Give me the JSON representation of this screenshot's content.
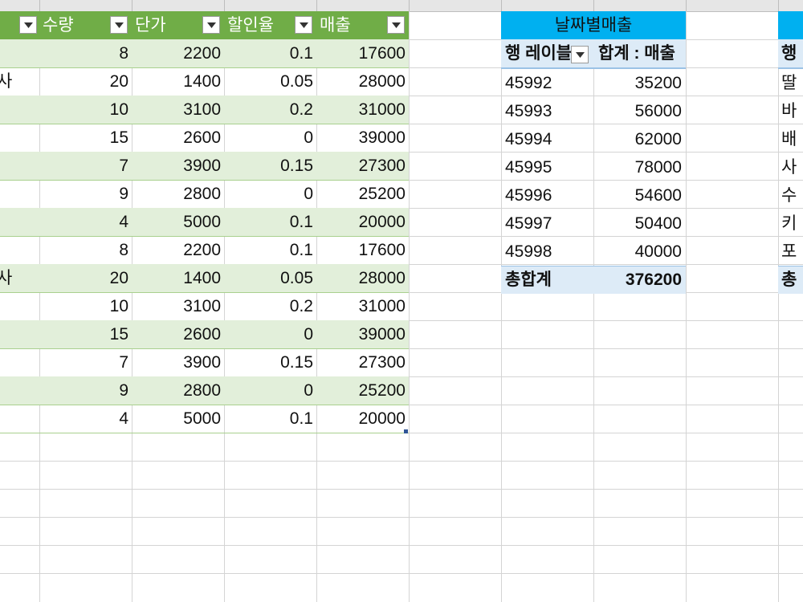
{
  "table": {
    "headers": [
      "수량",
      "단가",
      "할인율",
      "매출"
    ],
    "left_fragments": [
      "",
      "사",
      "",
      "",
      "",
      "",
      "",
      "",
      "사",
      "",
      "",
      "",
      "",
      ""
    ],
    "rows": [
      [
        "8",
        "2200",
        "0.1",
        "17600"
      ],
      [
        "20",
        "1400",
        "0.05",
        "28000"
      ],
      [
        "10",
        "3100",
        "0.2",
        "31000"
      ],
      [
        "15",
        "2600",
        "0",
        "39000"
      ],
      [
        "7",
        "3900",
        "0.15",
        "27300"
      ],
      [
        "9",
        "2800",
        "0",
        "25200"
      ],
      [
        "4",
        "5000",
        "0.1",
        "20000"
      ],
      [
        "8",
        "2200",
        "0.1",
        "17600"
      ],
      [
        "20",
        "1400",
        "0.05",
        "28000"
      ],
      [
        "10",
        "3100",
        "0.2",
        "31000"
      ],
      [
        "15",
        "2600",
        "0",
        "39000"
      ],
      [
        "7",
        "3900",
        "0.15",
        "27300"
      ],
      [
        "9",
        "2800",
        "0",
        "25200"
      ],
      [
        "4",
        "5000",
        "0.1",
        "20000"
      ]
    ],
    "colors": {
      "header": "#70ad47",
      "band": "#e2efda"
    }
  },
  "pivot_date": {
    "title": "날짜별매출",
    "row_label_header": "행 레이블",
    "value_header": "합계 : 매출",
    "rows": [
      [
        "45992",
        "35200"
      ],
      [
        "45993",
        "56000"
      ],
      [
        "45994",
        "62000"
      ],
      [
        "45995",
        "78000"
      ],
      [
        "45996",
        "54600"
      ],
      [
        "45997",
        "50400"
      ],
      [
        "45998",
        "40000"
      ]
    ],
    "total_label": "총합계",
    "total_value": "376200",
    "colors": {
      "title": "#00b0f0",
      "header": "#ddebf7"
    }
  },
  "pivot_product": {
    "row_label_header": "행",
    "rows": [
      "딸",
      "바",
      "배",
      "사",
      "수",
      "키",
      "포"
    ],
    "total_label": "총"
  },
  "icons": {
    "filter_dropdown": "chevron-down-icon"
  }
}
